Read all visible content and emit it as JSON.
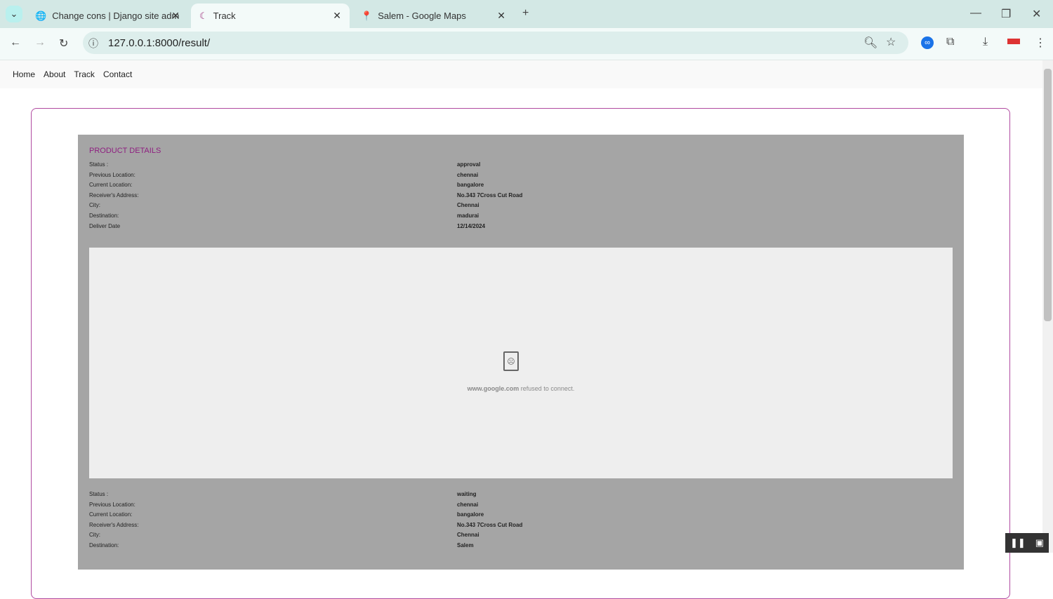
{
  "browser": {
    "tabs": [
      {
        "title": "Change cons | Django site adm",
        "active": false
      },
      {
        "title": "Track",
        "active": true
      },
      {
        "title": "Salem - Google Maps",
        "active": false
      }
    ],
    "url": "127.0.0.1:8000/result/"
  },
  "nav": [
    "Home",
    "About",
    "Track",
    "Contact"
  ],
  "product": {
    "title": "PRODUCT DETAILS",
    "labels": [
      "Status :",
      "Previous Location:",
      "Current Location:",
      "Receiver's Address:",
      "City:",
      "Destination:",
      "Deliver Date"
    ],
    "values": [
      "approval",
      "chennai",
      "bangalore",
      "No.343 7Cross Cut Road",
      "Chennai",
      "madurai",
      "12/14/2024"
    ]
  },
  "map_error": {
    "host": "www.google.com",
    "message": " refused to connect."
  },
  "product2": {
    "labels": [
      "Status :",
      "Previous Location:",
      "Current Location:",
      "Receiver's Address:",
      "City:",
      "Destination:"
    ],
    "values": [
      "waiting",
      "chennai",
      "bangalore",
      "No.343 7Cross Cut Road",
      "Chennai",
      "Salem"
    ]
  }
}
